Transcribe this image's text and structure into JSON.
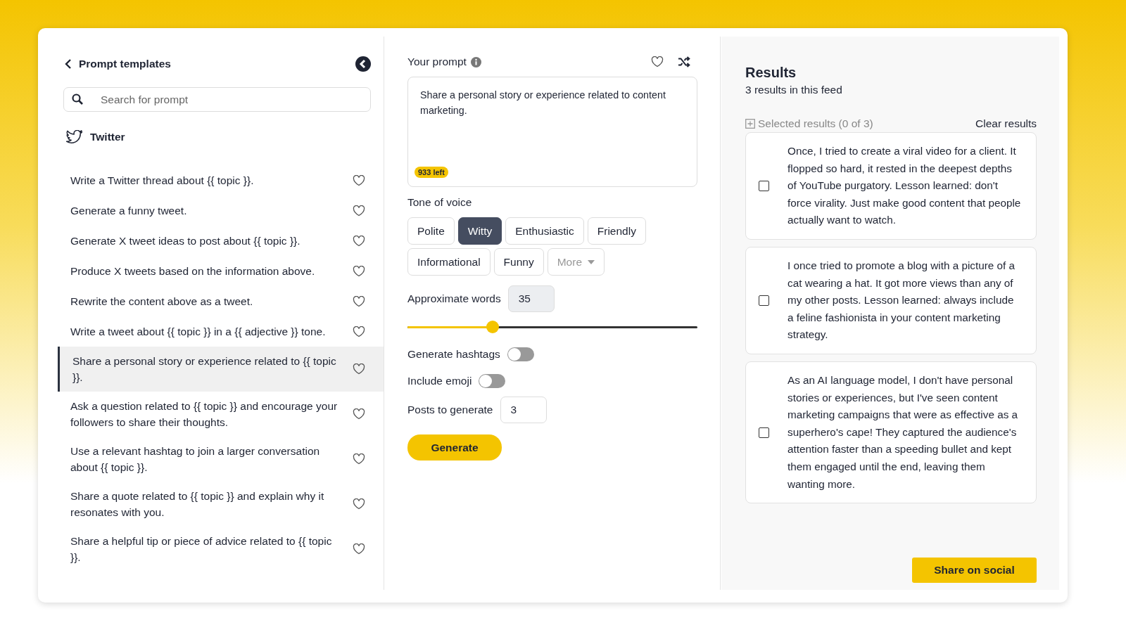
{
  "sidebar": {
    "title": "Prompt templates",
    "search": {
      "placeholder": "Search for prompt"
    },
    "section": "Twitter",
    "items": [
      {
        "text": "Write a Twitter thread about {{ topic }}.",
        "selected": false,
        "favorite": false
      },
      {
        "text": "Generate a funny tweet.",
        "selected": false,
        "favorite": false
      },
      {
        "text": "Generate X tweet ideas to post about {{ topic }}.",
        "selected": false,
        "favorite": false
      },
      {
        "text": "Produce X tweets based on the information above.",
        "selected": false,
        "favorite": false
      },
      {
        "text": "Rewrite the content above as a tweet.",
        "selected": false,
        "favorite": false
      },
      {
        "text": "Write a tweet about {{ topic }} in a {{ adjective }} tone.",
        "selected": false,
        "favorite": false
      },
      {
        "text": "Share a personal story or experience related to {{ topic }}.",
        "selected": true,
        "favorite": false
      },
      {
        "text": "Ask a question related to {{ topic }} and encourage your followers to share their thoughts.",
        "selected": false,
        "favorite": false
      },
      {
        "text": "Use a relevant hashtag to join a larger conversation about {{ topic }}.",
        "selected": false,
        "favorite": false
      },
      {
        "text": "Share a quote related to {{ topic }} and explain why it resonates with you.",
        "selected": false,
        "favorite": false
      },
      {
        "text": "Share a helpful tip or piece of advice related to {{ topic }}.",
        "selected": false,
        "favorite": false
      }
    ]
  },
  "prompt": {
    "label": "Your prompt",
    "favorite": false,
    "value": "Share a personal story or experience related to content marketing.",
    "remaining": "933 left",
    "tone_label": "Tone of voice",
    "tones": [
      {
        "label": "Polite",
        "kind": "option",
        "selected": false
      },
      {
        "label": "Witty",
        "kind": "option",
        "selected": true
      },
      {
        "label": "Enthusiastic",
        "kind": "option",
        "selected": false
      },
      {
        "label": "Friendly",
        "kind": "option",
        "selected": false
      },
      {
        "label": "Informational",
        "kind": "option",
        "selected": false
      },
      {
        "label": "Funny",
        "kind": "option",
        "selected": false
      },
      {
        "label": "More",
        "kind": "dropdown",
        "selected": false
      }
    ],
    "words_label": "Approximate words",
    "words": "35",
    "level": 0.285,
    "toggles": [
      {
        "label": "Generate hashtags",
        "on": false
      },
      {
        "label": "Include emoji",
        "on": false
      }
    ],
    "posts_label": "Posts to generate",
    "posts": "3",
    "generate": "Generate"
  },
  "results": {
    "title": "Results",
    "subtitle": "3 results in this feed",
    "selected_label": "Selected results (0 of 3)",
    "clear": "Clear results",
    "items": [
      {
        "text": "Once, I tried to create a viral video for a client. It flopped so hard, it rested in the deepest depths of YouTube purgatory. Lesson learned: don't force virality. Just make good content that people actually want to watch.",
        "checked": false
      },
      {
        "text": "I once tried to promote a blog with a picture of a cat wearing a hat. It got more views than any of my other posts. Lesson learned: always include a feline fashionista in your content marketing strategy.",
        "checked": false
      },
      {
        "text": "As an AI language model, I don't have personal stories or experiences, but I've seen content marketing campaigns that were as effective as a superhero's cape! They captured the audience's attention faster than a speeding bullet and kept them engaged until the end, leaving them wanting more.",
        "checked": false
      }
    ],
    "share": "Share on social"
  }
}
